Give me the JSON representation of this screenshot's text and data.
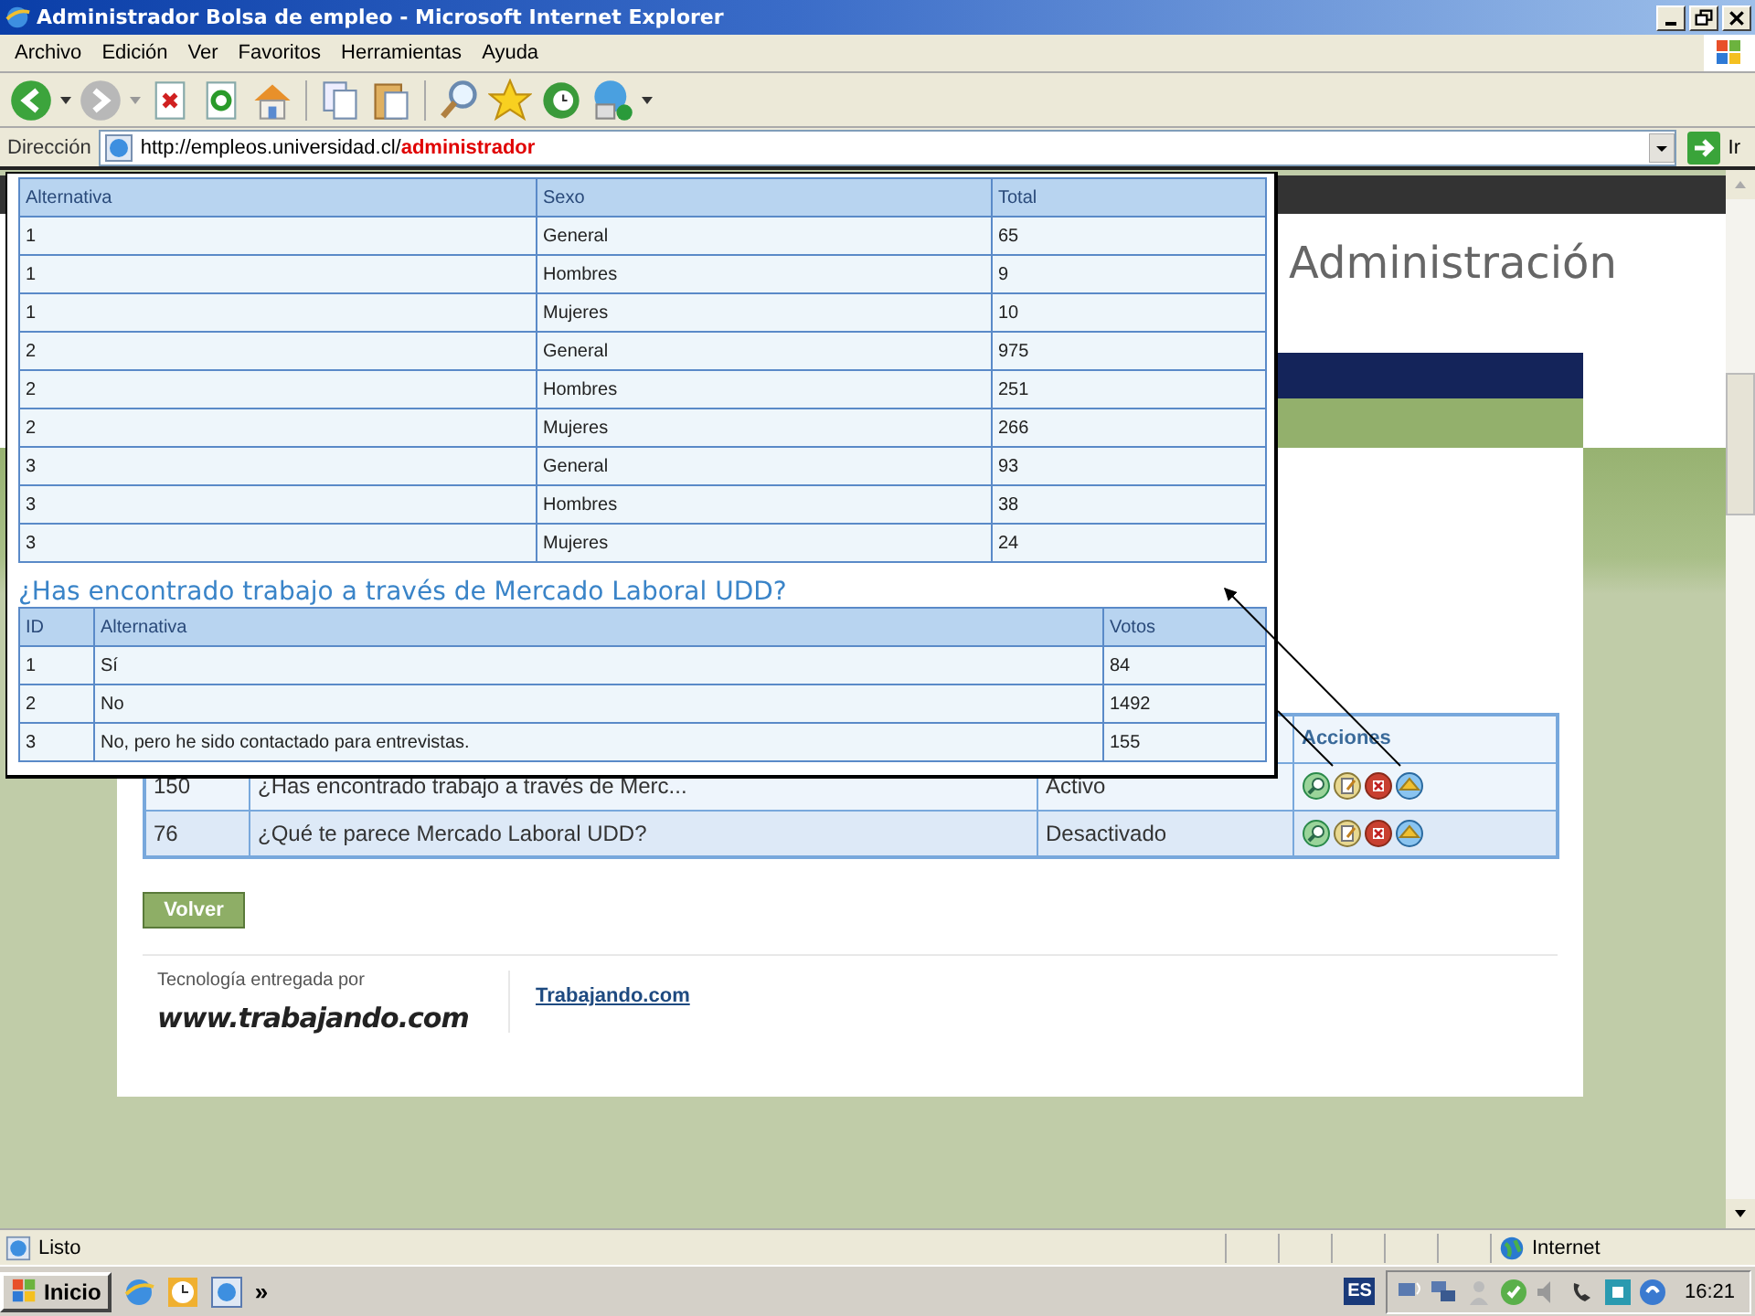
{
  "window": {
    "title": "Administrador Bolsa de empleo - Microsoft Internet Explorer"
  },
  "menu": [
    "Archivo",
    "Edición",
    "Ver",
    "Favoritos",
    "Herramientas",
    "Ayuda"
  ],
  "address": {
    "label": "Dirección",
    "url_base": "http://empleos.universidad.cl/",
    "url_path": "administrador",
    "go": "Ir"
  },
  "page": {
    "heading": "Administración",
    "table": {
      "columns": [
        "Acciones"
      ],
      "rows": [
        {
          "id": "150",
          "title": "¿Has encontrado trabajo a través de Merc...",
          "status": "Activo"
        },
        {
          "id": "76",
          "title": "¿Qué te parece Mercado Laboral UDD?",
          "status": "Desactivado"
        }
      ]
    },
    "back_button": "Volver",
    "footer": {
      "credit": "Tecnología entregada por",
      "logo": "www.trabajando.com",
      "link": "Trabajando.com"
    }
  },
  "popup": {
    "results_table": {
      "columns": [
        "Alternativa",
        "Sexo",
        "Total"
      ],
      "rows": [
        [
          "1",
          "General",
          "65"
        ],
        [
          "1",
          "Hombres",
          "9"
        ],
        [
          "1",
          "Mujeres",
          "10"
        ],
        [
          "2",
          "General",
          "975"
        ],
        [
          "2",
          "Hombres",
          "251"
        ],
        [
          "2",
          "Mujeres",
          "266"
        ],
        [
          "3",
          "General",
          "93"
        ],
        [
          "3",
          "Hombres",
          "38"
        ],
        [
          "3",
          "Mujeres",
          "24"
        ]
      ]
    },
    "question": "¿Has encontrado trabajo a través de Mercado Laboral UDD?",
    "votes_table": {
      "columns": [
        "ID",
        "Alternativa",
        "Votos"
      ],
      "rows": [
        [
          "1",
          "Sí",
          "84"
        ],
        [
          "2",
          "No",
          "1492"
        ],
        [
          "3",
          "No, pero he sido contactado para entrevistas.",
          "155"
        ]
      ]
    }
  },
  "status_bar": {
    "text": "Listo",
    "zone": "Internet"
  },
  "taskbar": {
    "start": "Inicio",
    "more": "»",
    "language": "ES",
    "clock": "16:21"
  }
}
